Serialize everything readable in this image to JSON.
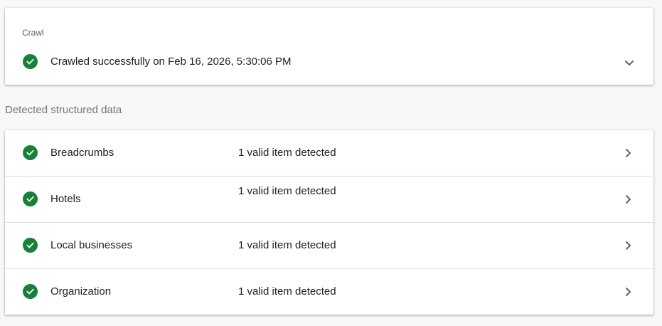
{
  "crawl": {
    "label": "Crawl",
    "status_text": "Crawled successfully on Feb 16, 2026, 5:30:06 PM",
    "icon": "check-circle-icon",
    "expand_icon": "chevron-down-icon"
  },
  "structured_data": {
    "heading": "Detected structured data",
    "rows": [
      {
        "name": "Breadcrumbs",
        "status": "1 valid item detected"
      },
      {
        "name": "Hotels",
        "status": "1 valid item detected"
      },
      {
        "name": "Local businesses",
        "status": "1 valid item detected"
      },
      {
        "name": "Organization",
        "status": "1 valid item detected"
      }
    ],
    "row_icon": "check-circle-icon",
    "row_action_icon": "chevron-right-icon"
  },
  "colors": {
    "success_green": "#188038",
    "background": "#f8f8f8",
    "card": "#ffffff",
    "muted_text": "#757575"
  }
}
